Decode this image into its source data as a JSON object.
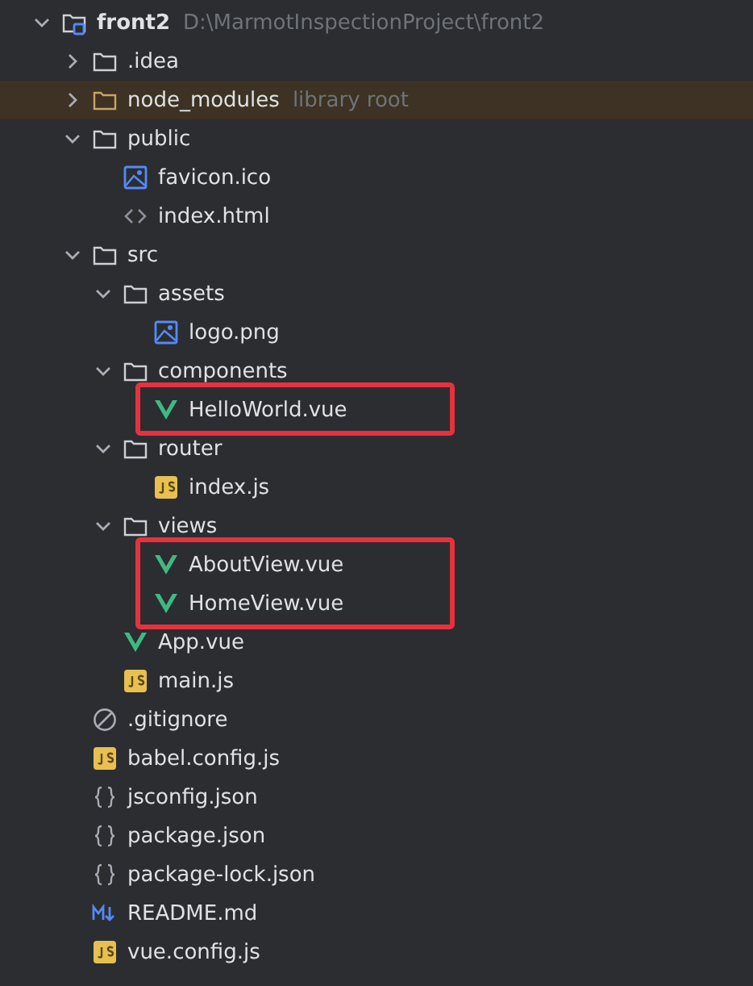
{
  "project_tree": {
    "items": [
      {
        "kind": "module",
        "name": "front2",
        "hint": "D:\\MarmotInspectionProject\\front2",
        "expanded": true,
        "children": [
          {
            "kind": "folder",
            "name": ".idea",
            "expanded": false
          },
          {
            "kind": "folder",
            "name": "node_modules",
            "hint": "library root",
            "expanded": false,
            "excluded": true
          },
          {
            "kind": "folder",
            "name": "public",
            "expanded": true,
            "children": [
              {
                "kind": "image",
                "name": "favicon.ico"
              },
              {
                "kind": "html",
                "name": "index.html"
              }
            ]
          },
          {
            "kind": "folder",
            "name": "src",
            "expanded": true,
            "children": [
              {
                "kind": "folder",
                "name": "assets",
                "expanded": true,
                "children": [
                  {
                    "kind": "image",
                    "name": "logo.png"
                  }
                ]
              },
              {
                "kind": "folder",
                "name": "components",
                "expanded": true,
                "children": [
                  {
                    "kind": "vue",
                    "name": "HelloWorld.vue",
                    "highlighted": true
                  }
                ]
              },
              {
                "kind": "folder",
                "name": "router",
                "expanded": true,
                "children": [
                  {
                    "kind": "js",
                    "name": "index.js"
                  }
                ]
              },
              {
                "kind": "folder",
                "name": "views",
                "expanded": true,
                "children": [
                  {
                    "kind": "vue",
                    "name": "AboutView.vue",
                    "highlighted": true
                  },
                  {
                    "kind": "vue",
                    "name": "HomeView.vue",
                    "highlighted": true
                  }
                ]
              },
              {
                "kind": "vue",
                "name": "App.vue"
              },
              {
                "kind": "js",
                "name": "main.js"
              }
            ]
          },
          {
            "kind": "gitignore",
            "name": ".gitignore"
          },
          {
            "kind": "js",
            "name": "babel.config.js"
          },
          {
            "kind": "json",
            "name": "jsconfig.json"
          },
          {
            "kind": "json",
            "name": "package.json"
          },
          {
            "kind": "json",
            "name": "package-lock.json"
          },
          {
            "kind": "md",
            "name": "README.md"
          },
          {
            "kind": "js",
            "name": "vue.config.js"
          }
        ]
      }
    ]
  }
}
